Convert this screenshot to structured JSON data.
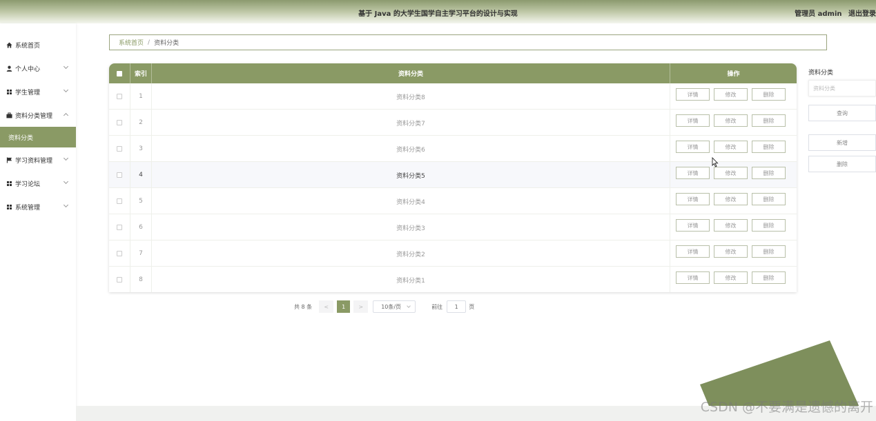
{
  "header": {
    "title": "基于 Java 的大学生国学自主学习平台的设计与实现",
    "user_label": "管理员 admin",
    "logout_label": "退出登录"
  },
  "sidebar": {
    "items": [
      {
        "label": "系统首页",
        "icon": "home-icon",
        "expandable": false
      },
      {
        "label": "个人中心",
        "icon": "user-icon",
        "expandable": true
      },
      {
        "label": "学生管理",
        "icon": "grid-icon",
        "expandable": true
      },
      {
        "label": "资料分类管理",
        "icon": "briefcase-icon",
        "expandable": true,
        "expanded": true
      },
      {
        "label": "学习资料管理",
        "icon": "flag-icon",
        "expandable": true
      },
      {
        "label": "学习论坛",
        "icon": "grid-icon",
        "expandable": true
      },
      {
        "label": "系统管理",
        "icon": "grid-icon",
        "expandable": true
      }
    ],
    "active_sub": "资料分类"
  },
  "breadcrumb": {
    "home": "系统首页",
    "separator": "/",
    "current": "资料分类"
  },
  "table": {
    "headers": {
      "index": "索引",
      "category": "资料分类",
      "actions": "操作"
    },
    "rows": [
      {
        "index": "1",
        "category": "资料分类8"
      },
      {
        "index": "2",
        "category": "资料分类7"
      },
      {
        "index": "3",
        "category": "资料分类6"
      },
      {
        "index": "4",
        "category": "资料分类5"
      },
      {
        "index": "5",
        "category": "资料分类4"
      },
      {
        "index": "6",
        "category": "资料分类3"
      },
      {
        "index": "7",
        "category": "资料分类2"
      },
      {
        "index": "8",
        "category": "资料分类1"
      }
    ],
    "action_labels": {
      "detail": "详情",
      "edit": "修改",
      "delete": "删除"
    }
  },
  "pagination": {
    "total": "共 8 条",
    "prev": "<",
    "current": "1",
    "next": ">",
    "page_size": "10条/页",
    "goto_label": "前往",
    "goto_value": "1",
    "page_unit": "页"
  },
  "search": {
    "label": "资料分类",
    "placeholder": "资料分类",
    "query_label": "查询",
    "add_label": "新增",
    "delete_label": "删除"
  },
  "watermark": "CSDN @不要满是遗憾的离开",
  "colors": {
    "accent": "#8a9a65",
    "deco": "#7e8f5c"
  }
}
